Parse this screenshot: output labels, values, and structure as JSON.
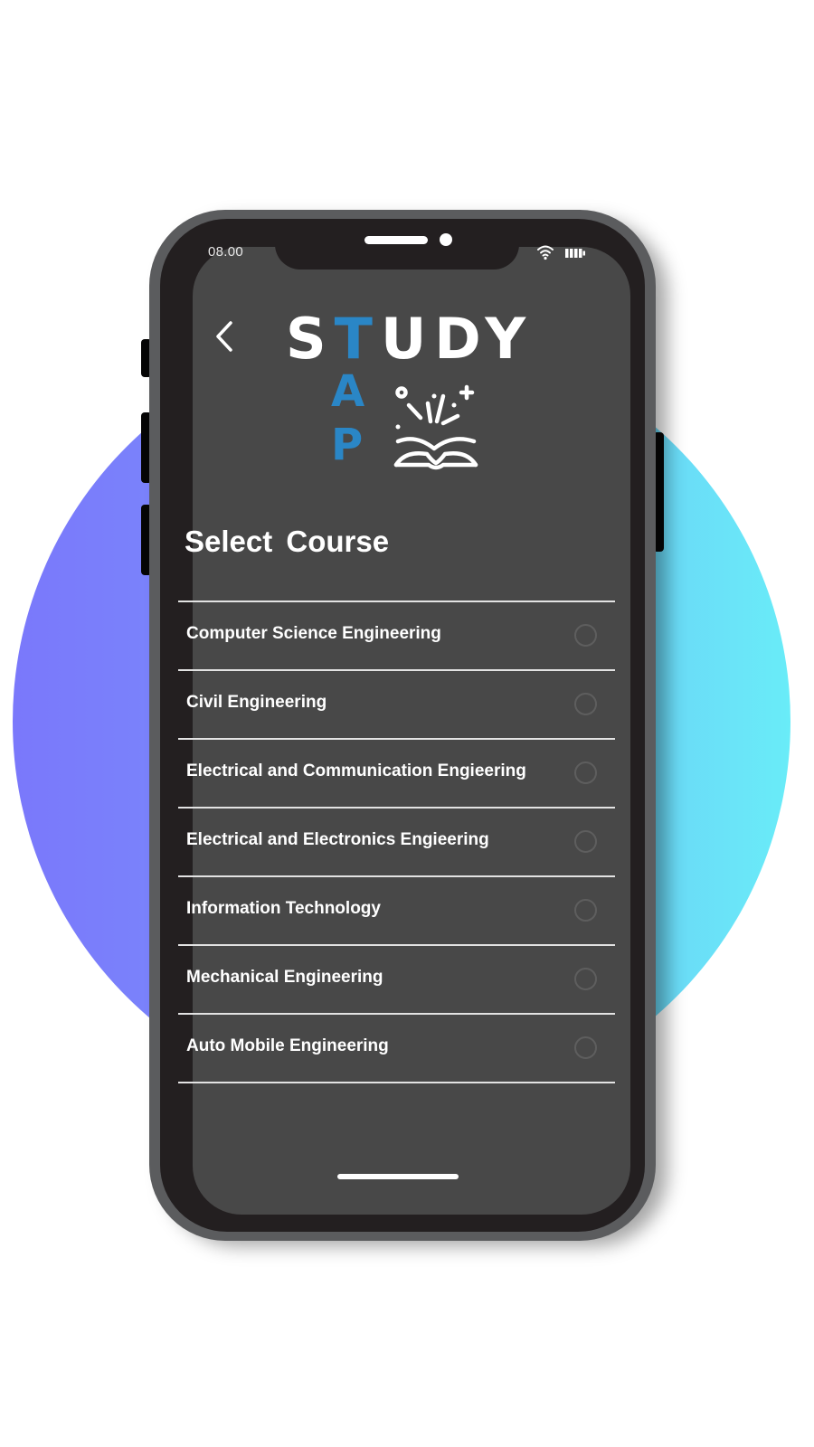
{
  "background": {
    "circle_gradient": [
      "#7a78fb",
      "#69ecf8"
    ]
  },
  "status_bar": {
    "time": "08.00",
    "icons": [
      "wifi-icon",
      "battery-icon"
    ]
  },
  "header": {
    "back_icon": "chevron-left-icon",
    "logo": {
      "word_prefix": "S",
      "word_accent": "T",
      "word_suffix": "UDY",
      "vertical_letters": [
        "A",
        "P"
      ],
      "icon": "open-book-sparkle-icon",
      "accent_color": "#2a86c6"
    }
  },
  "main": {
    "title": "Select  Course",
    "courses": [
      {
        "label": "Computer Science Engineering",
        "selected": false
      },
      {
        "label": "Civil Engineering",
        "selected": false
      },
      {
        "label": "Electrical and Communication Engieering",
        "selected": false
      },
      {
        "label": "Electrical and Electronics Engieering",
        "selected": false
      },
      {
        "label": "Information Technology",
        "selected": false
      },
      {
        "label": "Mechanical Engineering",
        "selected": false
      },
      {
        "label": "Auto Mobile Engineering",
        "selected": false
      }
    ]
  }
}
